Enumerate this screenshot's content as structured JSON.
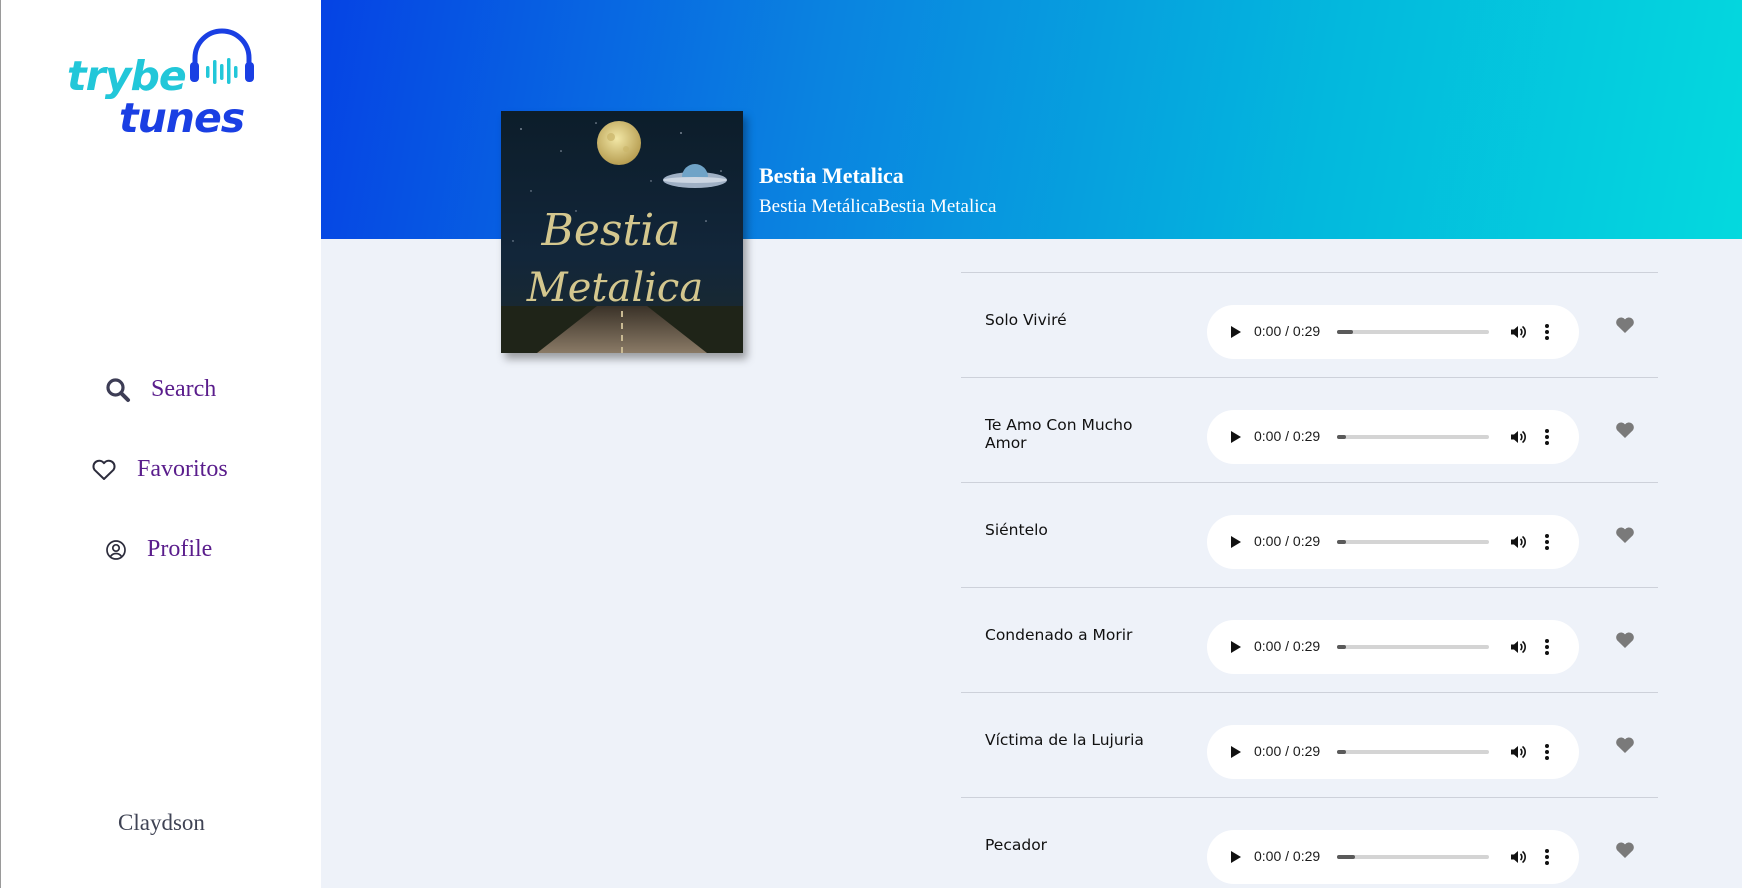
{
  "sidebar": {
    "logo": {
      "line1": "trybe",
      "line2": "tunes"
    },
    "nav": [
      {
        "label": "Search",
        "icon": "search-icon"
      },
      {
        "label": "Favoritos",
        "icon": "heart-outline-icon"
      },
      {
        "label": "Profile",
        "icon": "user-circle-icon"
      }
    ],
    "username": "Claydson"
  },
  "album": {
    "title": "Bestia Metalica",
    "artist_line": "Bestia MetálicaBestia Metalica",
    "cover_text": [
      "Bestia",
      "Metalica"
    ]
  },
  "tracks": [
    {
      "name": "Solo Viviré",
      "time": "0:00 / 0:29",
      "favorite": false
    },
    {
      "name": "Te Amo Con Mucho Amor",
      "time": "0:00 / 0:29",
      "favorite": false
    },
    {
      "name": "Siéntelo",
      "time": "0:00 / 0:29",
      "favorite": false
    },
    {
      "name": "Condenado a Morir",
      "time": "0:00 / 0:29",
      "favorite": false
    },
    {
      "name": "Víctima de la Lujuria",
      "time": "0:00 / 0:29",
      "favorite": false
    },
    {
      "name": "Pecador",
      "time": "0:00 / 0:29",
      "favorite": false
    }
  ],
  "colors": {
    "nav_text": "#5a1d8c",
    "banner_start": "#0543e4",
    "banner_end": "#04d9de",
    "logo_cyan": "#22c7d9",
    "logo_blue": "#1a3fe3"
  }
}
